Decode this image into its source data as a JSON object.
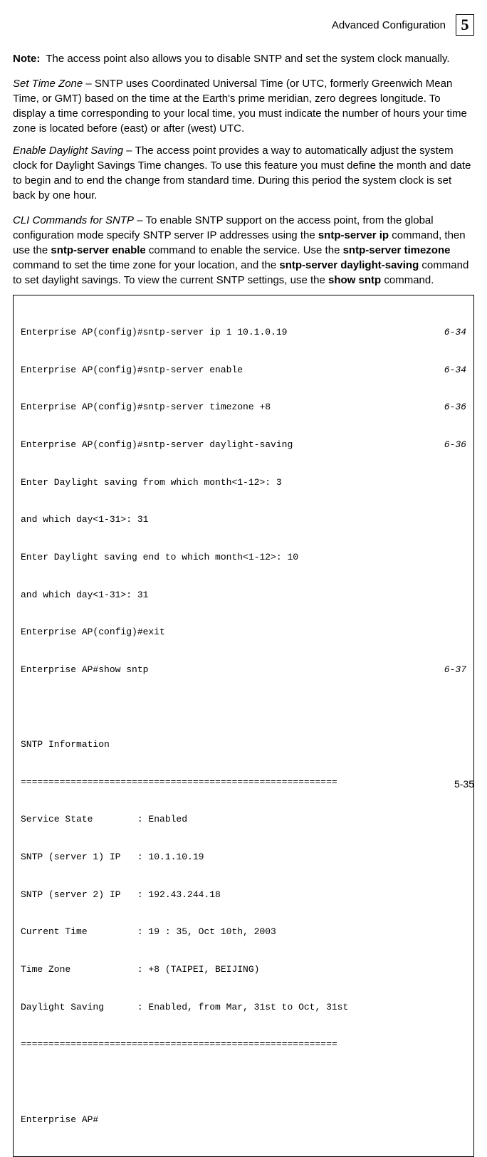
{
  "header": {
    "section": "Advanced Configuration",
    "chapter": "5"
  },
  "note": {
    "label": "Note:",
    "text": "The access point also allows you to disable SNTP and set the system clock manually."
  },
  "para1": {
    "lead": "Set Time Zone – ",
    "body": "SNTP uses Coordinated Universal Time (or UTC, formerly Greenwich Mean Time, or GMT) based on the time at the Earth's prime meridian, zero degrees longitude. To display a time corresponding to your local time, you must indicate the number of hours your time zone is located before (east) or after (west) UTC."
  },
  "para2": {
    "lead": "Enable Daylight Saving – ",
    "body": "The access point provides a way to automatically adjust the system clock for Daylight Savings Time changes. To use this feature you must define the month and date to begin and to end the change from standard time. During this period the system clock is set back by one hour."
  },
  "para3": {
    "lead_italic": "CLI Commands for SNTP",
    "dash": " – ",
    "seg1": "To enable SNTP support on the access point, from the global configuration mode specify SNTP server IP addresses using the ",
    "b1": "sntp-server ip",
    "seg2": " command, then use the ",
    "b2": "sntp-server enable",
    "seg3": " command to enable the service. Use the ",
    "b3": "sntp-server timezone",
    "seg4": " command to set the time zone for your location, and the ",
    "b4": "sntp-server daylight-saving",
    "seg5": " command to set daylight savings. To view the current SNTP settings, use the ",
    "b5": "show sntp",
    "seg6": " command."
  },
  "code": {
    "l1": {
      "left": "Enterprise AP(config)#sntp-server ip 1 10.1.0.19",
      "right": "6-34"
    },
    "l2": {
      "left": "Enterprise AP(config)#sntp-server enable",
      "right": "6-34"
    },
    "l3": {
      "left": "Enterprise AP(config)#sntp-server timezone +8",
      "right": "6-36"
    },
    "l4": {
      "left": "Enterprise AP(config)#sntp-server daylight-saving",
      "right": "6-36"
    },
    "l5": "Enter Daylight saving from which month<1-12>: 3",
    "l6": "and which day<1-31>: 31",
    "l7": "Enter Daylight saving end to which month<1-12>: 10",
    "l8": "and which day<1-31>: 31",
    "l9": "Enterprise AP(config)#exit",
    "l10": {
      "left": "Enterprise AP#show sntp",
      "right": "6-37"
    },
    "l11": "",
    "l12": "SNTP Information",
    "l13": "=========================================================",
    "l14": "Service State        : Enabled",
    "l15": "SNTP (server 1) IP   : 10.1.10.19",
    "l16": "SNTP (server 2) IP   : 192.43.244.18",
    "l17": "Current Time         : 19 : 35, Oct 10th, 2003",
    "l18": "Time Zone            : +8 (TAIPEI, BEIJING)",
    "l19": "Daylight Saving      : Enabled, from Mar, 31st to Oct, 31st",
    "l20": "=========================================================",
    "l21": "",
    "l22": "Enterprise AP#"
  },
  "page_number": "5-35"
}
